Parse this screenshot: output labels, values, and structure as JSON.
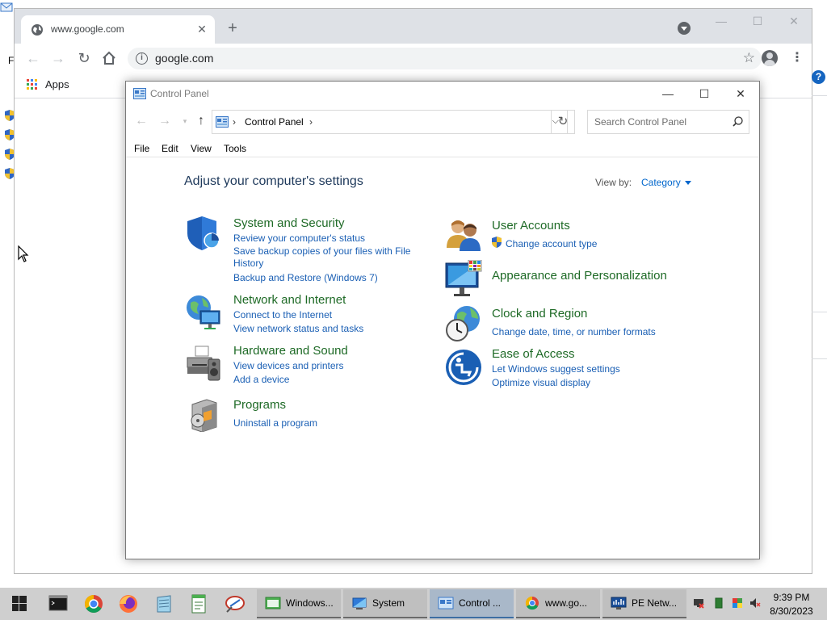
{
  "background": {
    "menu_fragment": "Fi"
  },
  "chrome": {
    "tab_title": "www.google.com",
    "url": "google.com",
    "bookmarks": {
      "apps_label": "Apps"
    }
  },
  "control_panel": {
    "window_title": "Control Panel",
    "address_path": "Control Panel",
    "search_placeholder": "Search Control Panel",
    "menu": {
      "file": "File",
      "edit": "Edit",
      "view": "View",
      "tools": "Tools"
    },
    "heading": "Adjust your computer's settings",
    "view_by_label": "View by:",
    "view_by_value": "Category",
    "categories": {
      "system_security": {
        "title": "System and Security",
        "links": [
          "Review your computer's status",
          "Save backup copies of your files with File History",
          "Backup and Restore (Windows 7)"
        ]
      },
      "network": {
        "title": "Network and Internet",
        "links": [
          "Connect to the Internet",
          "View network status and tasks"
        ]
      },
      "hardware": {
        "title": "Hardware and Sound",
        "links": [
          "View devices and printers",
          "Add a device"
        ]
      },
      "programs": {
        "title": "Programs",
        "links": [
          "Uninstall a program"
        ]
      },
      "user_accounts": {
        "title": "User Accounts",
        "links": [
          "Change account type"
        ]
      },
      "appearance": {
        "title": "Appearance and Personalization",
        "links": []
      },
      "clock": {
        "title": "Clock and Region",
        "links": [
          "Change date, time, or number formats"
        ]
      },
      "ease": {
        "title": "Ease of Access",
        "links": [
          "Let Windows suggest settings",
          "Optimize visual display"
        ]
      }
    }
  },
  "taskbar": {
    "tasks": [
      "Windows...",
      "System",
      "Control ...",
      "www.go...",
      "PE Netw..."
    ],
    "time": "9:39 PM",
    "date": "8/30/2023"
  },
  "colors": {
    "category_title": "#1e6a26",
    "link": "#1a5fb4",
    "heading": "#1e395b",
    "taskbar": "#cfcfcf"
  }
}
